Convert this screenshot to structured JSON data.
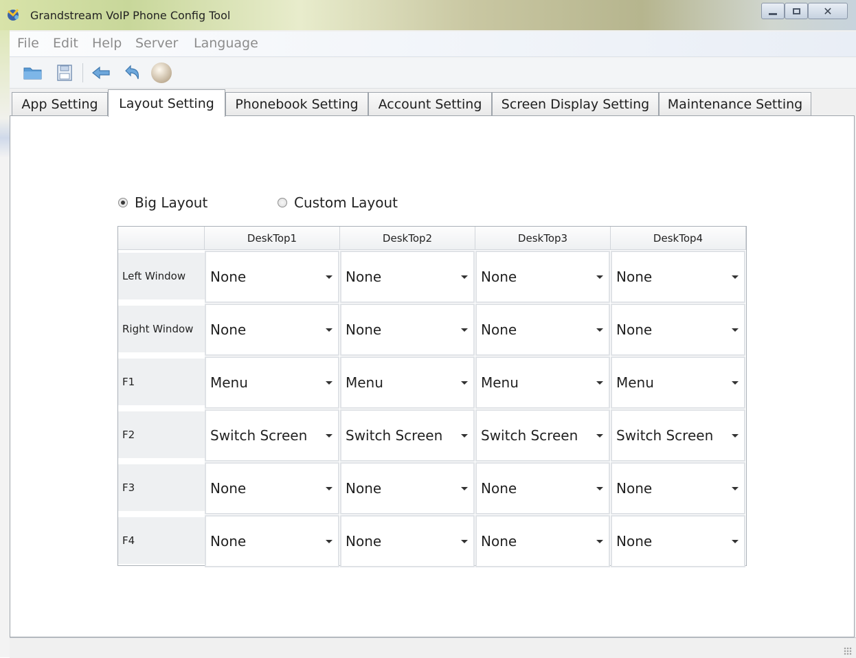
{
  "window": {
    "title": "Grandstream VoIP Phone Config Tool"
  },
  "menubar": {
    "items": [
      "File",
      "Edit",
      "Help",
      "Server",
      "Language"
    ]
  },
  "toolbar": {
    "buttons": [
      "open-folder-icon",
      "save-icon",
      "back-arrow-icon",
      "undo-icon",
      "ball-icon"
    ]
  },
  "tabs": [
    {
      "label": "App Setting"
    },
    {
      "label": "Layout Setting"
    },
    {
      "label": "Phonebook Setting"
    },
    {
      "label": "Account Setting"
    },
    {
      "label": "Screen Display Setting"
    },
    {
      "label": "Maintenance Setting"
    }
  ],
  "active_tab": "Layout Setting",
  "layout_options": {
    "big": {
      "label": "Big Layout",
      "checked": true
    },
    "custom": {
      "label": "Custom Layout",
      "checked": false
    }
  },
  "grid": {
    "columns": [
      "DeskTop1",
      "DeskTop2",
      "DeskTop3",
      "DeskTop4"
    ],
    "rows": [
      {
        "label": "Left Window",
        "values": [
          "None",
          "None",
          "None",
          "None"
        ]
      },
      {
        "label": "Right Window",
        "values": [
          "None",
          "None",
          "None",
          "None"
        ]
      },
      {
        "label": "F1",
        "values": [
          "Menu",
          "Menu",
          "Menu",
          "Menu"
        ]
      },
      {
        "label": "F2",
        "values": [
          "Switch Screen",
          "Switch Screen",
          "Switch Screen",
          "Switch Screen"
        ]
      },
      {
        "label": "F3",
        "values": [
          "None",
          "None",
          "None",
          "None"
        ]
      },
      {
        "label": "F4",
        "values": [
          "None",
          "None",
          "None",
          "None"
        ]
      }
    ]
  }
}
